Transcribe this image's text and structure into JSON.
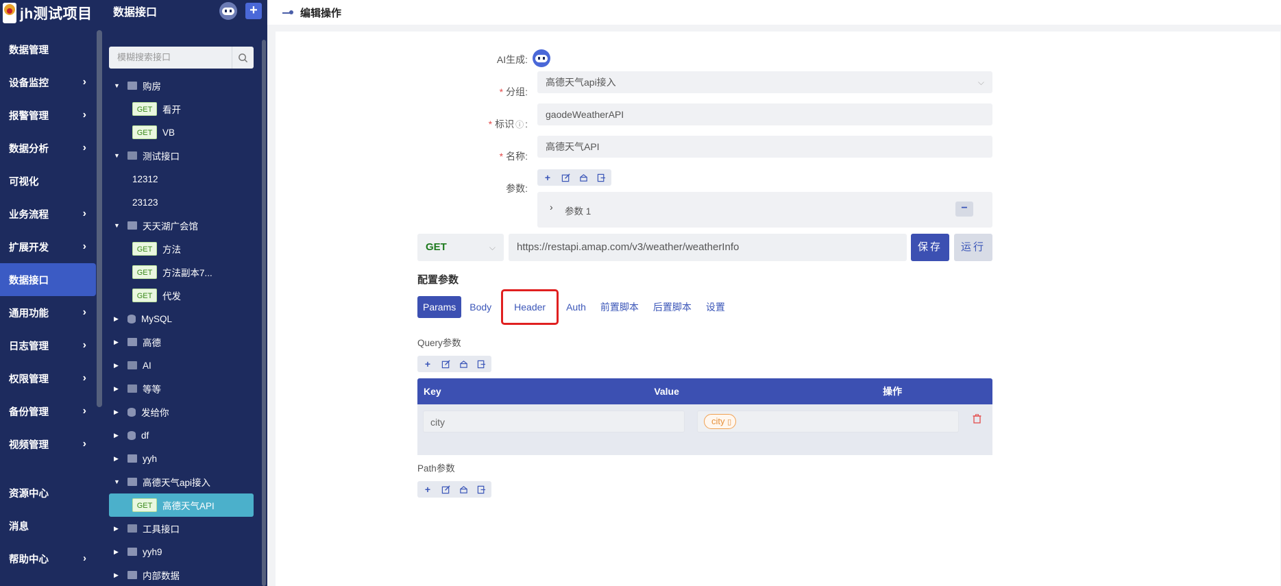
{
  "nav": {
    "brand": "jh测试项目",
    "items": [
      {
        "label": "数据管理",
        "chev": false
      },
      {
        "label": "设备监控",
        "chev": true
      },
      {
        "label": "报警管理",
        "chev": true
      },
      {
        "label": "数据分析",
        "chev": true
      },
      {
        "label": "可视化",
        "chev": false
      },
      {
        "label": "业务流程",
        "chev": true
      },
      {
        "label": "扩展开发",
        "chev": true
      },
      {
        "label": "数据接口",
        "chev": false,
        "active": true
      },
      {
        "label": "通用功能",
        "chev": true
      },
      {
        "label": "日志管理",
        "chev": true
      },
      {
        "label": "权限管理",
        "chev": true
      },
      {
        "label": "备份管理",
        "chev": true
      },
      {
        "label": "视频管理",
        "chev": true
      }
    ],
    "bottom": [
      {
        "label": "资源中心"
      },
      {
        "label": "消息"
      },
      {
        "label": "帮助中心"
      }
    ]
  },
  "sidebar": {
    "title": "数据接口",
    "search_placeholder": "模糊搜索接口",
    "tree": [
      {
        "type": "folder",
        "icon": "http",
        "label": "购房",
        "open": true
      },
      {
        "type": "leaf",
        "method": "GET",
        "label": "看开"
      },
      {
        "type": "leaf",
        "method": "GET",
        "label": "VB"
      },
      {
        "type": "folder",
        "icon": "code",
        "label": "测试接口",
        "open": true
      },
      {
        "type": "plain",
        "label": "12312"
      },
      {
        "type": "plain",
        "label": "23123"
      },
      {
        "type": "folder",
        "icon": "http",
        "label": "天天湖广会馆",
        "open": true
      },
      {
        "type": "leaf",
        "method": "GET",
        "label": "方法"
      },
      {
        "type": "leaf",
        "method": "GET",
        "label": "方法副本7..."
      },
      {
        "type": "leaf",
        "method": "GET",
        "label": "代发"
      },
      {
        "type": "folder",
        "icon": "db",
        "label": "MySQL",
        "open": false
      },
      {
        "type": "folder",
        "icon": "http",
        "label": "高德",
        "open": false
      },
      {
        "type": "folder",
        "icon": "code",
        "label": "AI",
        "open": false
      },
      {
        "type": "folder",
        "icon": "code",
        "label": "等等",
        "open": false
      },
      {
        "type": "folder",
        "icon": "db",
        "label": "发给你",
        "open": false
      },
      {
        "type": "folder",
        "icon": "db",
        "label": "df",
        "open": false
      },
      {
        "type": "folder",
        "icon": "http",
        "label": "yyh",
        "open": false
      },
      {
        "type": "folder",
        "icon": "http",
        "label": "高德天气api接入",
        "open": true
      },
      {
        "type": "leaf",
        "method": "GET",
        "label": "高德天气API",
        "selected": true
      },
      {
        "type": "folder",
        "icon": "code",
        "label": "工具接口",
        "open": false
      },
      {
        "type": "folder",
        "icon": "grid",
        "label": "yyh9",
        "open": false
      },
      {
        "type": "folder",
        "icon": "grid",
        "label": "内部数据",
        "open": false
      }
    ]
  },
  "header": {
    "title": "编辑操作"
  },
  "form": {
    "ai_label": "AI生成:",
    "group_label": "分组:",
    "group_value": "高德天气api接入",
    "id_label": "标识",
    "id_value": "gaodeWeatherAPI",
    "name_label": "名称:",
    "name_value": "高德天气API",
    "params_label": "参数:",
    "param_item": "参数 1"
  },
  "request": {
    "method": "GET",
    "url": "https://restapi.amap.com/v3/weather/weatherInfo",
    "save": "保存",
    "run": "运行"
  },
  "config": {
    "title": "配置参数",
    "tabs": [
      "Params",
      "Body",
      "Header",
      "Auth",
      "前置脚本",
      "后置脚本",
      "设置"
    ],
    "active_tab": "Params",
    "highlighted_tab": "Header",
    "highlight_color": "#e02020"
  },
  "query": {
    "label": "Query参数",
    "columns": [
      "Key",
      "Value",
      "操作"
    ],
    "rows": [
      {
        "key": "city",
        "value": "city"
      }
    ]
  },
  "path": {
    "label": "Path参数"
  },
  "colors": {
    "nav_bg": "#1d2b5e",
    "accent": "#3c50b2",
    "selected": "#4bb0cb"
  }
}
